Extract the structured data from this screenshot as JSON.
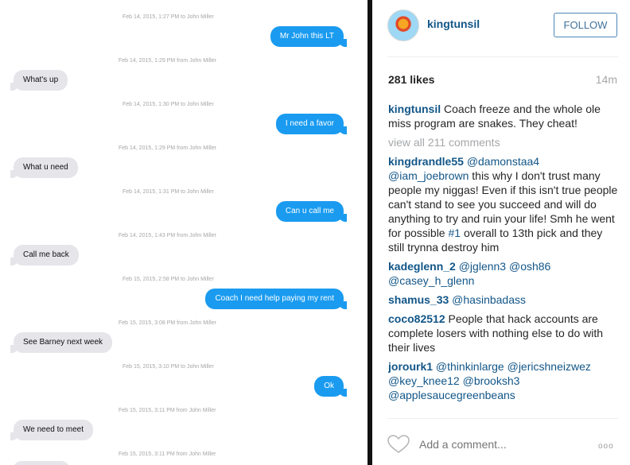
{
  "chat": {
    "timestamps": [
      "Feb 14, 2015, 1:27 PM to John Miller",
      "Feb 14, 2015, 1:29 PM from John Miller",
      "Feb 14, 2015, 1:30 PM to John Miller",
      "Feb 14, 2015, 1:29 PM from John Miller",
      "Feb 14, 2015, 1:31 PM to John Miller",
      "Feb 14, 2015, 1:43 PM from John Miller",
      "Feb 15, 2015, 2:58 PM to John Miller",
      "Feb 15, 2015, 3:08 PM from John Miller",
      "Feb 15, 2015, 3:10 PM to John Miller",
      "Feb 15, 2015, 3:11 PM from John Miller",
      "Feb 15, 2015, 3:11 PM from John Miller"
    ],
    "messages": [
      {
        "dir": "out",
        "text": "Mr John this LT"
      },
      {
        "dir": "in",
        "text": "What's up"
      },
      {
        "dir": "out",
        "text": "I need a favor"
      },
      {
        "dir": "in",
        "text": "What u need"
      },
      {
        "dir": "out",
        "text": "Can u call me"
      },
      {
        "dir": "in",
        "text": "Call me back"
      },
      {
        "dir": "out",
        "text": "Coach I need help paying my rent"
      },
      {
        "dir": "in",
        "text": "See Barney next week"
      },
      {
        "dir": "out",
        "text": "Ok"
      },
      {
        "dir": "in",
        "text": "We need to meet"
      }
    ]
  },
  "post": {
    "username": "kingtunsil",
    "follow_label": "FOLLOW",
    "likes": "281 likes",
    "time": "14m",
    "caption_user": "kingtunsil",
    "caption_text": "Coach freeze and the whole ole miss program are snakes. They cheat!",
    "view_all": "view all 211 comments",
    "comment_placeholder": "Add a comment...",
    "more_glyph": "ooo"
  },
  "comments": [
    {
      "user": "kingdrandle55",
      "parts": [
        {
          "t": "mention",
          "v": "@damonstaa4"
        },
        {
          "t": "text",
          "v": " "
        },
        {
          "t": "mention",
          "v": "@iam_joebrown"
        },
        {
          "t": "text",
          "v": " this why I don't trust many people my niggas! Even if this isn't true people can't stand to see you succeed and will do anything to try and ruin your life! Smh he went for possible "
        },
        {
          "t": "mention",
          "v": "#1"
        },
        {
          "t": "text",
          "v": " overall to 13th pick and they still trynna destroy him"
        }
      ]
    },
    {
      "user": "kadeglenn_2",
      "parts": [
        {
          "t": "mention",
          "v": "@jglenn3"
        },
        {
          "t": "text",
          "v": " "
        },
        {
          "t": "mention",
          "v": "@osh86"
        },
        {
          "t": "text",
          "v": " "
        },
        {
          "t": "mention",
          "v": "@casey_h_glenn"
        }
      ]
    },
    {
      "user": "shamus_33",
      "parts": [
        {
          "t": "mention",
          "v": "@hasinbadass"
        }
      ]
    },
    {
      "user": "coco82512",
      "parts": [
        {
          "t": "text",
          "v": "People that hack accounts are complete losers with nothing else to do with their lives"
        }
      ]
    },
    {
      "user": "jorourk1",
      "parts": [
        {
          "t": "mention",
          "v": "@thinkinlarge"
        },
        {
          "t": "text",
          "v": " "
        },
        {
          "t": "mention",
          "v": "@jericshneizwez"
        },
        {
          "t": "text",
          "v": " "
        },
        {
          "t": "mention",
          "v": "@key_knee12"
        },
        {
          "t": "text",
          "v": " "
        },
        {
          "t": "mention",
          "v": "@brooksh3"
        },
        {
          "t": "text",
          "v": " "
        },
        {
          "t": "mention",
          "v": "@applesaucegreenbeans"
        }
      ]
    }
  ],
  "colors": {
    "bubble_out": "#1a9bf0",
    "bubble_in": "#e5e5ea",
    "link": "#125688"
  }
}
